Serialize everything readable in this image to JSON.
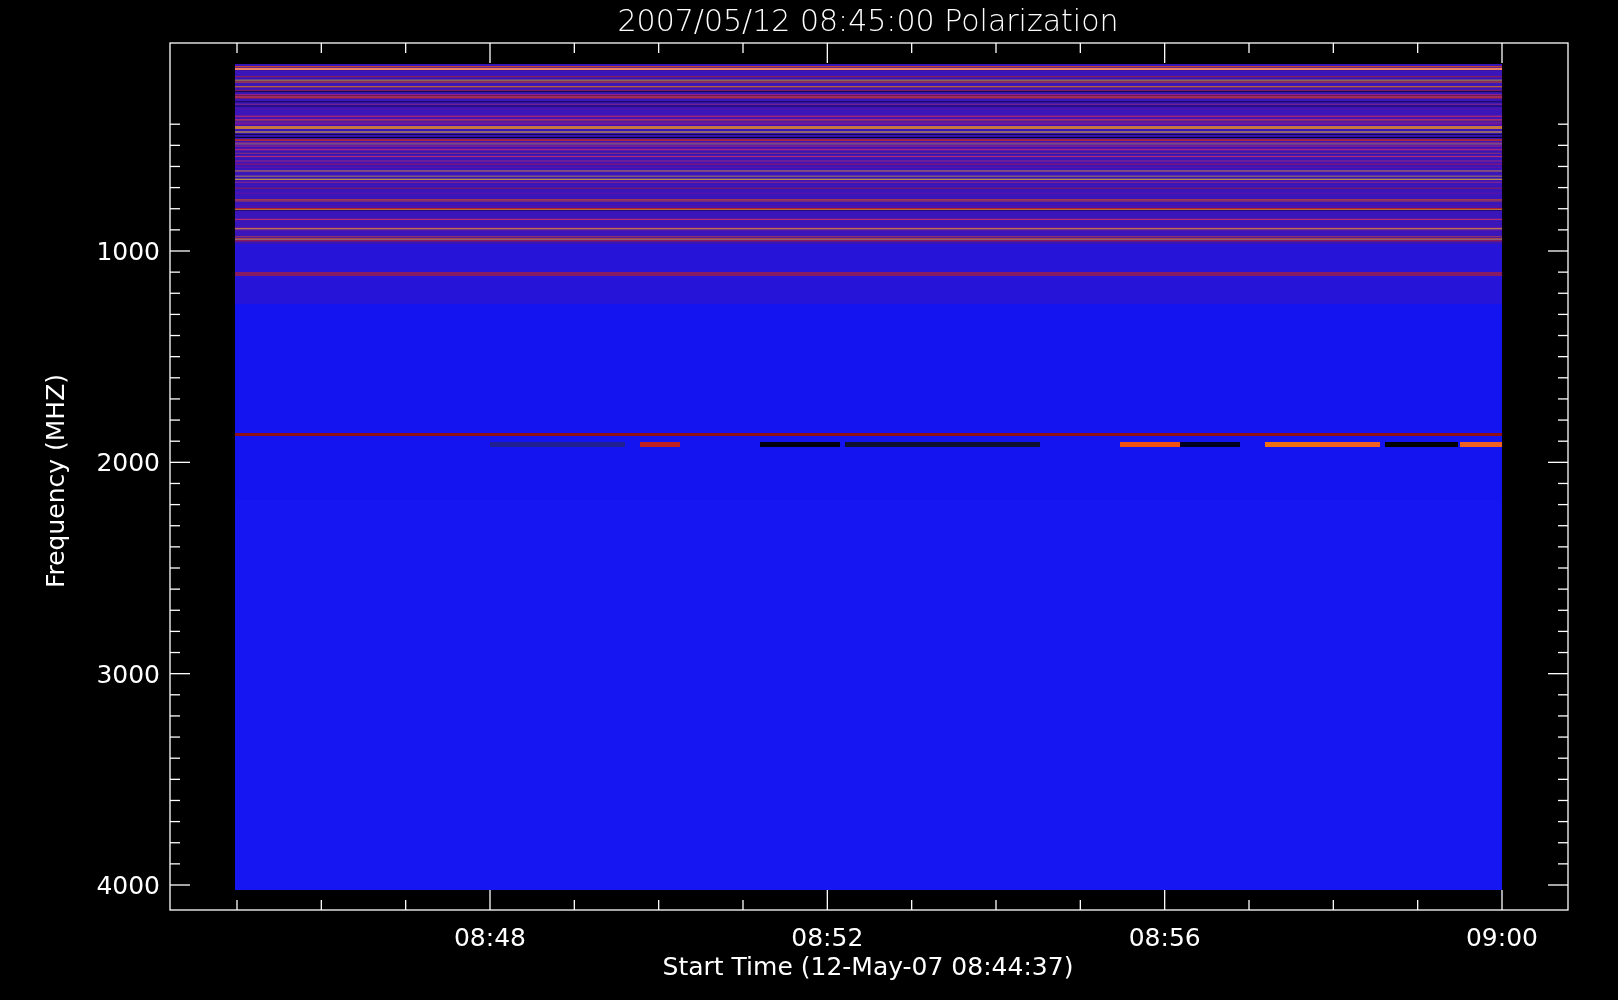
{
  "title": "2007/05/12 08:45:00 Polarization",
  "y_axis": {
    "label": "Frequency (MHZ)",
    "ticks": [
      "1000",
      "2000",
      "3000",
      "4000"
    ]
  },
  "x_axis": {
    "label": "Start Time (12-May-07 08:44:37)",
    "ticks": [
      "08:48",
      "08:52",
      "08:56",
      "09:00"
    ]
  }
}
